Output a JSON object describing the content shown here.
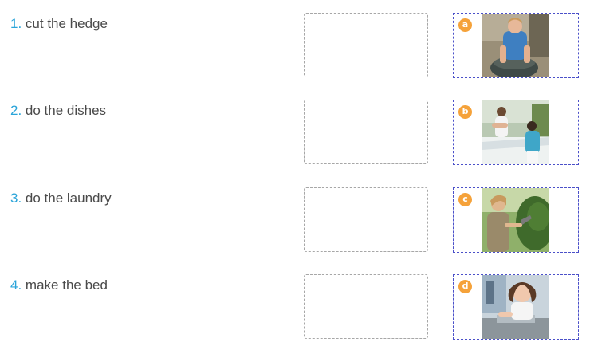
{
  "items": [
    {
      "number": "1.",
      "text": "cut the hedge",
      "letter": "a",
      "photo_icon": "man-washing-clothes-photo"
    },
    {
      "number": "2.",
      "text": "do the dishes",
      "letter": "b",
      "photo_icon": "people-making-bed-photo"
    },
    {
      "number": "3.",
      "text": "do the laundry",
      "letter": "c",
      "photo_icon": "woman-cutting-hedge-photo"
    },
    {
      "number": "4.",
      "text": "make the bed",
      "letter": "d",
      "photo_icon": "girl-washing-dishes-photo"
    }
  ],
  "colors": {
    "number": "#2aa4d9",
    "text": "#4a4a4a",
    "badge": "#f5a23a",
    "card_border": "#4b50c9",
    "drop_border": "#a7a7a7"
  }
}
